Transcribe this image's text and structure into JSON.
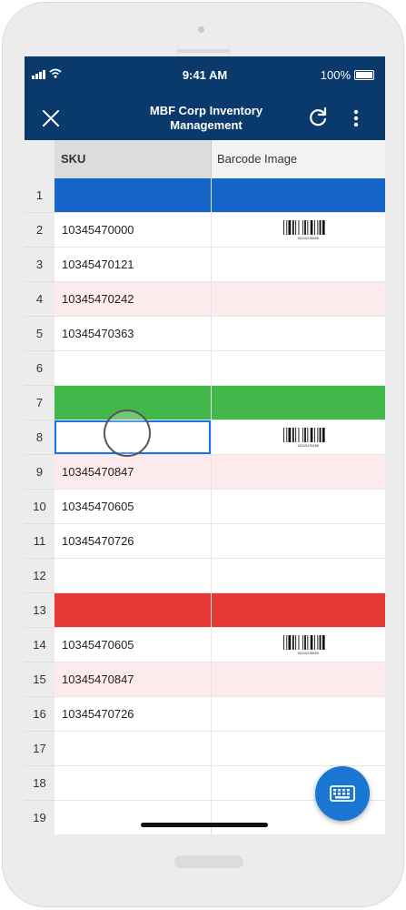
{
  "status": {
    "time": "9:41 AM",
    "battery": "100%"
  },
  "header": {
    "title_line1": "MBF Corp Inventory",
    "title_line2": "Management",
    "close_icon": "close-icon",
    "refresh_icon": "refresh-icon",
    "more_icon": "more-vertical-icon"
  },
  "columns": {
    "sku": "SKU",
    "barcode": "Barcode Image"
  },
  "rows": [
    {
      "num": "1",
      "sku": "",
      "style": "blue",
      "barcode": false
    },
    {
      "num": "2",
      "sku": "10345470000",
      "style": "",
      "barcode": true,
      "barcode_text": "10345470000"
    },
    {
      "num": "3",
      "sku": "10345470121",
      "style": "",
      "barcode": false
    },
    {
      "num": "4",
      "sku": "10345470242",
      "style": "pink",
      "barcode": false
    },
    {
      "num": "5",
      "sku": "10345470363",
      "style": "",
      "barcode": false
    },
    {
      "num": "6",
      "sku": "",
      "style": "",
      "barcode": false
    },
    {
      "num": "7",
      "sku": "",
      "style": "green",
      "barcode": false
    },
    {
      "num": "8",
      "sku": "",
      "style": "selected",
      "barcode": true,
      "barcode_text": "10345470486"
    },
    {
      "num": "9",
      "sku": "10345470847",
      "style": "pink",
      "barcode": false
    },
    {
      "num": "10",
      "sku": "10345470605",
      "style": "",
      "barcode": false
    },
    {
      "num": "11",
      "sku": "10345470726",
      "style": "",
      "barcode": false
    },
    {
      "num": "12",
      "sku": "",
      "style": "",
      "barcode": false
    },
    {
      "num": "13",
      "sku": "",
      "style": "red",
      "barcode": false
    },
    {
      "num": "14",
      "sku": "10345470605",
      "style": "",
      "barcode": true,
      "barcode_text": "10345470605"
    },
    {
      "num": "15",
      "sku": "10345470847",
      "style": "pink",
      "barcode": false
    },
    {
      "num": "16",
      "sku": "10345470726",
      "style": "",
      "barcode": false
    },
    {
      "num": "17",
      "sku": "",
      "style": "",
      "barcode": false
    },
    {
      "num": "18",
      "sku": "",
      "style": "",
      "barcode": false
    },
    {
      "num": "19",
      "sku": "",
      "style": "",
      "barcode": false
    }
  ],
  "fab": {
    "icon": "keyboard-icon"
  },
  "colors": {
    "header_bg": "#0a3a6b",
    "row_blue": "#1565c8",
    "row_green": "#41b649",
    "row_red": "#e53935",
    "row_pink": "#fdeaec",
    "selection": "#1a73e8",
    "fab": "#1976d2"
  }
}
